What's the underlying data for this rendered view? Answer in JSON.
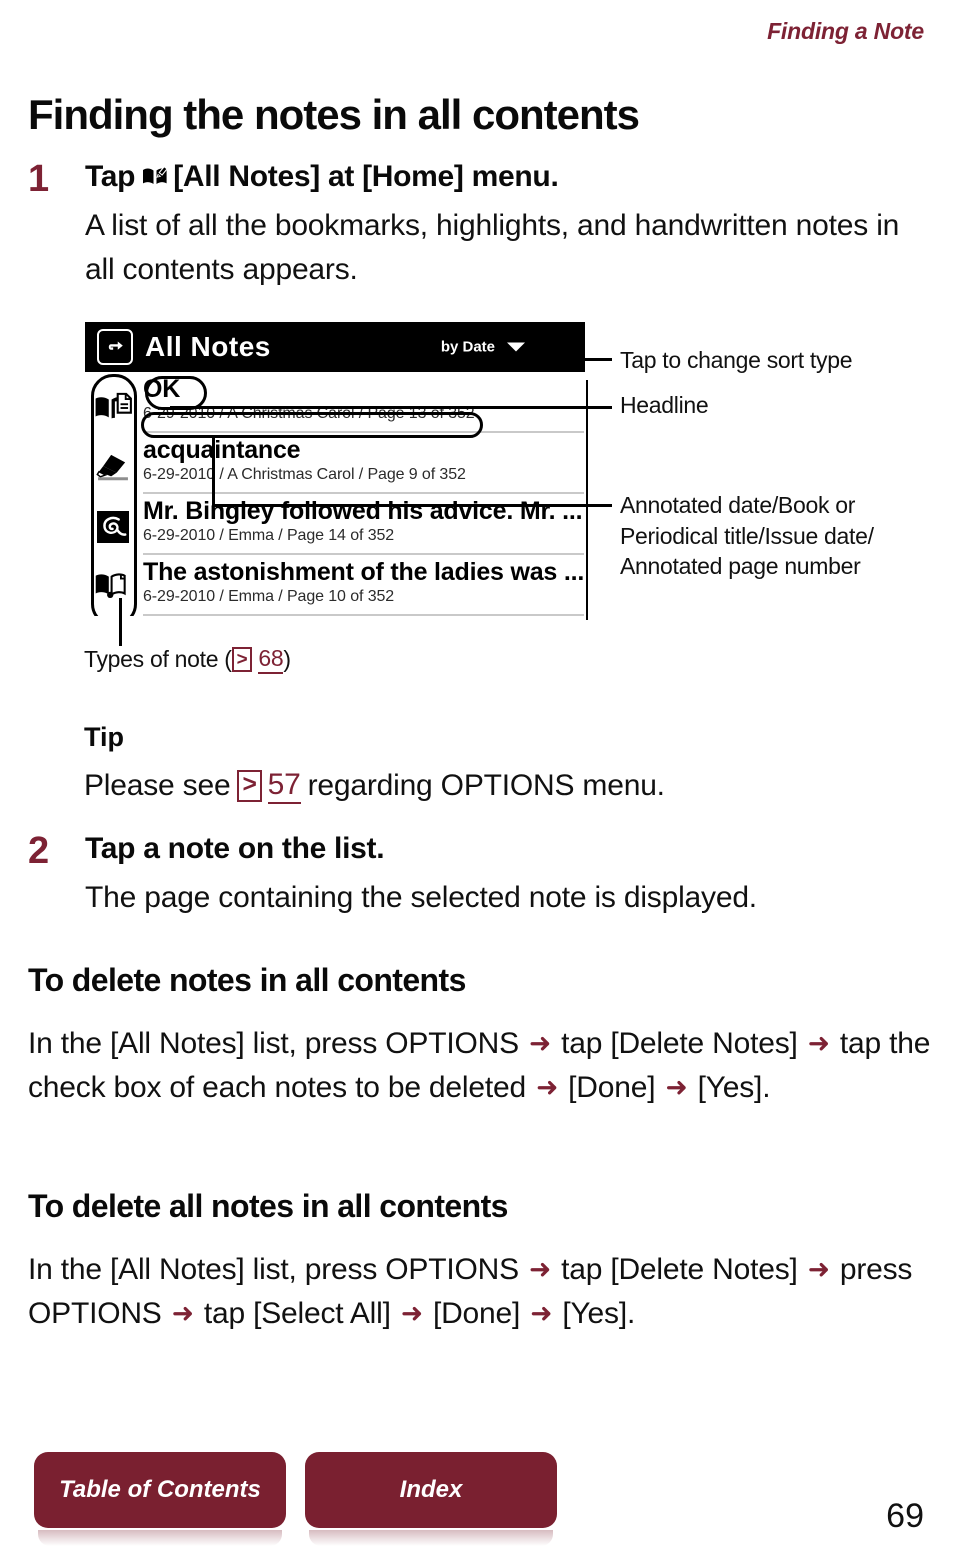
{
  "header": {
    "running_head": "Finding a Note",
    "accent_color": "#7d2234"
  },
  "chapter_title": "Finding the notes in all contents",
  "steps": [
    {
      "number": "1",
      "heading_before_icon": "Tap",
      "icon": "book-with-pen-icon",
      "heading_after_icon": "[All Notes] at [Home] menu.",
      "body": "A list of all the bookmarks, highlights, and handwritten notes in all contents appears."
    },
    {
      "number": "2",
      "heading": "Tap a note on the list.",
      "body": "The page containing the selected note is displayed."
    }
  ],
  "figure": {
    "device": {
      "back_icon": "back-arrow-icon",
      "screen_title": "All Notes",
      "sort_label": "by Date",
      "sort_caret": "chevron-down-icon",
      "notes": [
        {
          "type_icon": "book-note-icon",
          "title": "OK",
          "meta": "6-29-2010 / A Christmas Carol / Page 13 of 352"
        },
        {
          "type_icon": "highlighter-icon",
          "title": "acquaintance",
          "meta": "6-29-2010 / A Christmas Carol / Page 9 of 352"
        },
        {
          "type_icon": "handwriting-icon",
          "title": "Mr. Bingley followed his advice. Mr. ...",
          "meta": "6-29-2010 / Emma / Page 14 of 352"
        },
        {
          "type_icon": "bookmark-icon",
          "title": "The astonishment of the ladies was ...",
          "meta": "6-29-2010 / Emma / Page 10 of 352"
        }
      ]
    },
    "callouts": [
      {
        "id": "sort",
        "text": "Tap to change sort type"
      },
      {
        "id": "headline",
        "text": "Headline"
      },
      {
        "id": "meta",
        "text": "Annotated date/Book or Periodical title/Issue date/ Annotated page number"
      }
    ],
    "caption": {
      "text": "Types of note (",
      "ref_icon": "page-reference-icon",
      "ref_page": "68",
      "text_end": ")"
    }
  },
  "tip": {
    "heading": "Tip",
    "text_before": "Please see",
    "ref_icon": "page-reference-icon",
    "ref_page": "57",
    "text_after": "regarding OPTIONS menu."
  },
  "sections": [
    {
      "heading": "To delete notes in all contents",
      "parts": [
        "In the [All Notes] list, press OPTIONS",
        "tap [Delete Notes]",
        "tap the check box of each notes to be deleted",
        "[Done]",
        "[Yes]."
      ]
    },
    {
      "heading": "To delete all notes in all contents",
      "parts": [
        "In the [All Notes] list, press OPTIONS",
        "tap [Delete Notes]",
        "press OPTIONS",
        "tap [Select All]",
        "[Done]",
        "[Yes]."
      ]
    }
  ],
  "footer": {
    "toc_label": "Table of Contents",
    "index_label": "Index",
    "page_number": "69",
    "button_color": "#7a2030"
  }
}
